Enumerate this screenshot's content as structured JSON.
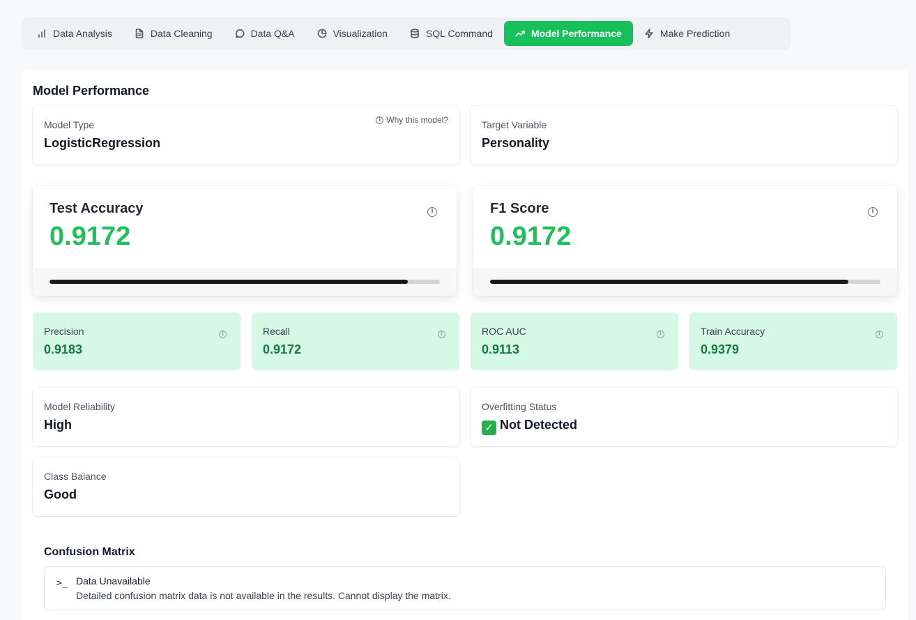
{
  "tabs": [
    {
      "label": "Data Analysis",
      "icon": "bar-chart-icon",
      "active": false
    },
    {
      "label": "Data Cleaning",
      "icon": "file-text-icon",
      "active": false
    },
    {
      "label": "Data Q&A",
      "icon": "message-circle-icon",
      "active": false
    },
    {
      "label": "Visualization",
      "icon": "pie-chart-icon",
      "active": false
    },
    {
      "label": "SQL Command",
      "icon": "database-icon",
      "active": false
    },
    {
      "label": "Model Performance",
      "icon": "trending-up-icon",
      "active": true
    },
    {
      "label": "Make Prediction",
      "icon": "zap-icon",
      "active": false
    }
  ],
  "colors": {
    "accent": "#16c05a",
    "metric_green": "#1fbf5c",
    "light_green": "#d5f9e4",
    "dark_green": "#157a44"
  },
  "section_title": "Model Performance",
  "model_type": {
    "label": "Model Type",
    "value": "LogisticRegression",
    "why_label": "Why this model?"
  },
  "target_variable": {
    "label": "Target Variable",
    "value": "Personality"
  },
  "test_accuracy": {
    "label": "Test Accuracy",
    "value": "0.9172",
    "progress": 0.9172
  },
  "f1_score": {
    "label": "F1 Score",
    "value": "0.9172",
    "progress": 0.9172
  },
  "small_metrics": [
    {
      "label": "Precision",
      "value": "0.9183"
    },
    {
      "label": "Recall",
      "value": "0.9172"
    },
    {
      "label": "ROC AUC",
      "value": "0.9113"
    },
    {
      "label": "Train Accuracy",
      "value": "0.9379"
    }
  ],
  "reliability": {
    "label": "Model Reliability",
    "value": "High"
  },
  "overfitting": {
    "label": "Overfitting Status",
    "value": "Not Detected",
    "icon": "check-mark-icon"
  },
  "class_balance": {
    "label": "Class Balance",
    "value": "Good"
  },
  "confusion_matrix": {
    "title": "Confusion Matrix",
    "alert_title": "Data Unavailable",
    "alert_desc": "Detailed confusion matrix data is not available in the results. Cannot display the matrix.",
    "alert_icon": ">_"
  }
}
